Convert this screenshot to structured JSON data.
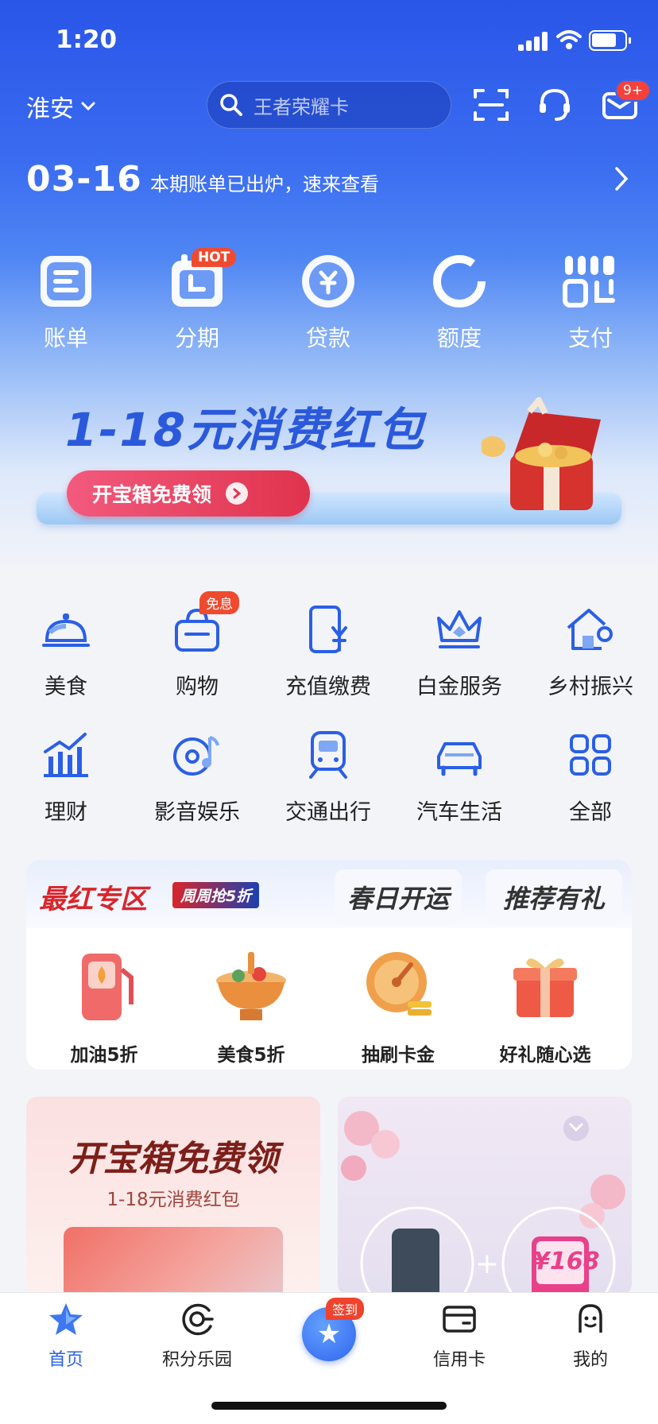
{
  "status": {
    "time": "1:20"
  },
  "topbar": {
    "city": "淮安",
    "search_placeholder": "王者荣耀卡",
    "mail_badge": "9+"
  },
  "bill": {
    "date": "03-16",
    "message": "本期账单已出炉，速来查看"
  },
  "main_nav": [
    {
      "label": "账单",
      "icon": "bill-icon"
    },
    {
      "label": "分期",
      "icon": "installment-icon",
      "badge": "HOT"
    },
    {
      "label": "贷款",
      "icon": "loan-icon"
    },
    {
      "label": "额度",
      "icon": "credit-limit-icon"
    },
    {
      "label": "支付",
      "icon": "payment-icon"
    }
  ],
  "banner": {
    "title": "1-18元消费红包",
    "button": "开宝箱免费领"
  },
  "services": [
    {
      "label": "美食",
      "icon": "food-cloche-icon"
    },
    {
      "label": "购物",
      "icon": "shopping-basket-icon",
      "badge": "免息"
    },
    {
      "label": "充值缴费",
      "icon": "recharge-icon"
    },
    {
      "label": "白金服务",
      "icon": "crown-icon"
    },
    {
      "label": "乡村振兴",
      "icon": "village-icon"
    },
    {
      "label": "理财",
      "icon": "chart-icon"
    },
    {
      "label": "影音娱乐",
      "icon": "music-icon"
    },
    {
      "label": "交通出行",
      "icon": "train-icon"
    },
    {
      "label": "汽车生活",
      "icon": "car-icon"
    },
    {
      "label": "全部",
      "icon": "grid-icon"
    }
  ],
  "zone": {
    "tabs": [
      "最红专区",
      "春日开运",
      "推荐有礼"
    ],
    "tag": "周周抢5折",
    "items": [
      {
        "label": "加油5折",
        "icon": "fuel-pump-icon"
      },
      {
        "label": "美食5折",
        "icon": "hotpot-icon"
      },
      {
        "label": "抽刷卡金",
        "icon": "lucky-wheel-icon"
      },
      {
        "label": "好礼随心选",
        "icon": "gift-box-icon"
      }
    ]
  },
  "cards": {
    "left_title": "开宝箱免费领",
    "left_sub": "1-18元消费红包",
    "right_price": "¥168"
  },
  "tabbar": [
    {
      "label": "首页",
      "icon": "star-icon",
      "active": true
    },
    {
      "label": "积分乐园",
      "icon": "points-icon"
    },
    {
      "label": "",
      "icon": "checkin-icon",
      "badge": "签到"
    },
    {
      "label": "信用卡",
      "icon": "card-icon"
    },
    {
      "label": "我的",
      "icon": "profile-icon"
    }
  ],
  "colors": {
    "brand_blue": "#2a55e8",
    "badge_red": "#f04a2e",
    "active_tab": "#2a62e9"
  }
}
